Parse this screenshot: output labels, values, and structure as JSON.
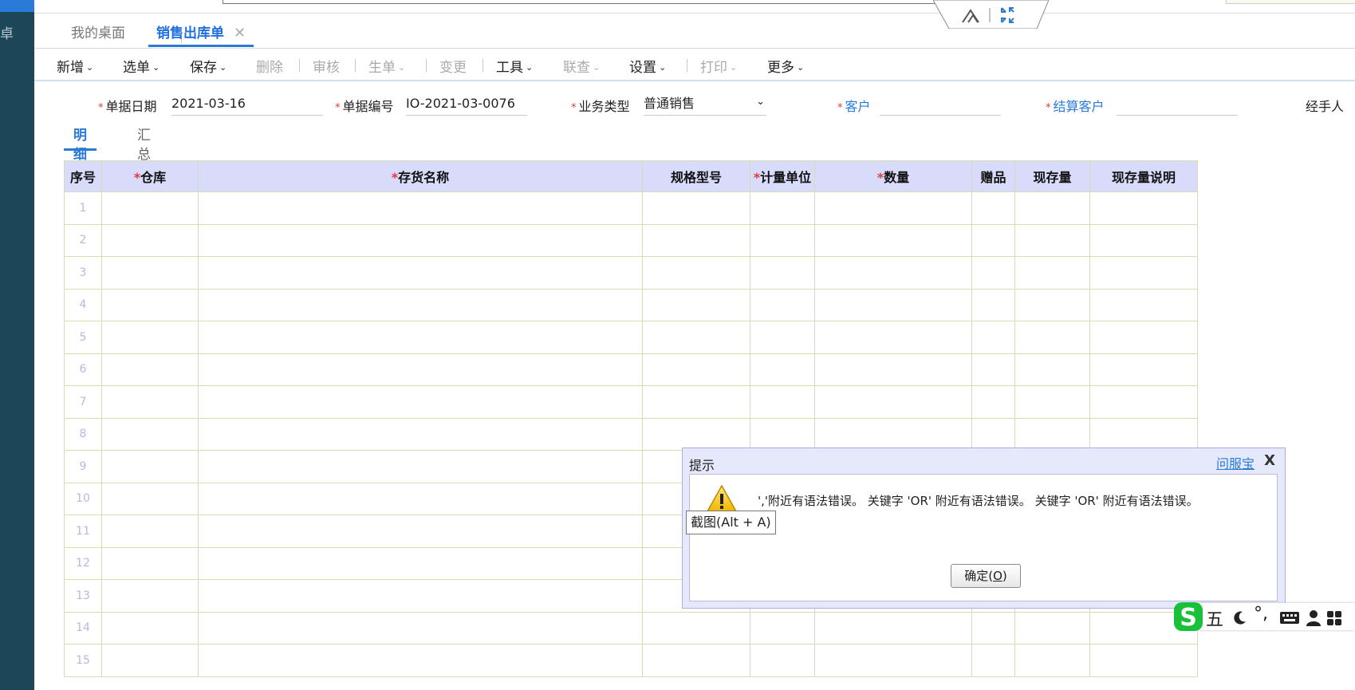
{
  "sidebar": {
    "glyph": "卓"
  },
  "tabs": [
    {
      "label": "我的桌面",
      "active": false
    },
    {
      "label": "销售出库单",
      "active": true,
      "close": "✕"
    }
  ],
  "toolbar": {
    "items": [
      {
        "label": "新增",
        "enabled": true,
        "dropdown": true
      },
      {
        "label": "选单",
        "enabled": true,
        "dropdown": true
      },
      {
        "label": "保存",
        "enabled": true,
        "dropdown": true
      },
      {
        "label": "删除",
        "enabled": false,
        "dropdown": false
      },
      {
        "label": "审核",
        "enabled": false,
        "dropdown": false
      },
      {
        "label": "生单",
        "enabled": false,
        "dropdown": true
      },
      {
        "label": "变更",
        "enabled": false,
        "dropdown": false
      },
      {
        "label": "工具",
        "enabled": true,
        "dropdown": true
      },
      {
        "label": "联查",
        "enabled": false,
        "dropdown": true
      },
      {
        "label": "设置",
        "enabled": true,
        "dropdown": true
      },
      {
        "label": "打印",
        "enabled": false,
        "dropdown": true
      },
      {
        "label": "更多",
        "enabled": true,
        "dropdown": true
      }
    ]
  },
  "form": {
    "date_label": "单据日期",
    "date_value": "2021-03-16",
    "code_label": "单据编号",
    "code_value": "IO-2021-03-0076",
    "biztype_label": "业务类型",
    "biztype_value": "普通销售",
    "customer_label": "客户",
    "customer_value": "",
    "settle_label": "结算客户",
    "settle_value": "",
    "handler_label": "经手人"
  },
  "subtabs": [
    {
      "label": "明细",
      "active": true
    },
    {
      "label": "汇总",
      "active": false
    }
  ],
  "grid": {
    "columns": [
      {
        "label": "序号",
        "required": false
      },
      {
        "label": "仓库",
        "required": true
      },
      {
        "label": "存货名称",
        "required": true
      },
      {
        "label": "规格型号",
        "required": false
      },
      {
        "label": "计量单位",
        "required": true
      },
      {
        "label": "数量",
        "required": true
      },
      {
        "label": "赠品",
        "required": false
      },
      {
        "label": "现存量",
        "required": false
      },
      {
        "label": "现存量说明",
        "required": false
      }
    ],
    "row_numbers": [
      "1",
      "2",
      "3",
      "4",
      "5",
      "6",
      "7",
      "8",
      "9",
      "10",
      "11",
      "12",
      "13",
      "14",
      "15"
    ]
  },
  "dialog": {
    "title": "提示",
    "help_link": "问服宝",
    "close": "X",
    "message": "','附近有语法错误。 关键字 'OR' 附近有语法错误。 关键字 'OR' 附近有语法错误。",
    "ok_label_prefix": "确定(",
    "ok_label_key": "O",
    "ok_label_suffix": ")"
  },
  "tooltip": {
    "text": "截图(Alt + A)"
  },
  "ime": {
    "mode": "五",
    "punct": "°,",
    "logo_letter": "S"
  },
  "colors": {
    "sidebar": "#1e4659",
    "accent": "#2a7bd8",
    "header_bg": "#d9dbfb",
    "required": "#e23b3b"
  }
}
